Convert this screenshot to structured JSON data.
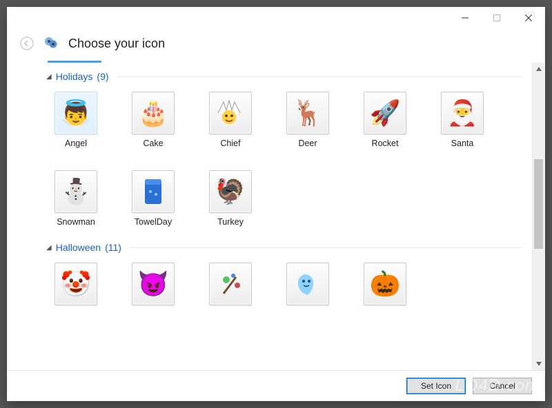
{
  "titlebar": {
    "minimize": "–",
    "maximize": "□",
    "close": "✕"
  },
  "header": {
    "title": "Choose your icon"
  },
  "categories": [
    {
      "name": "Holidays",
      "count": 9,
      "items": [
        {
          "label": "Angel",
          "emoji": "👼",
          "selected": true
        },
        {
          "label": "Cake",
          "emoji": "🎂"
        },
        {
          "label": "Chief",
          "emoji": "😀"
        },
        {
          "label": "Deer",
          "emoji": "🦌"
        },
        {
          "label": "Rocket",
          "emoji": "🚀"
        },
        {
          "label": "Santa",
          "emoji": "🎅"
        },
        {
          "label": "Snowman",
          "emoji": "⛄"
        },
        {
          "label": "TowelDay",
          "emoji": "🟦"
        },
        {
          "label": "Turkey",
          "emoji": "🦃"
        }
      ]
    },
    {
      "name": "Halloween",
      "count": 11,
      "items": [
        {
          "label": "",
          "emoji": "🤡"
        },
        {
          "label": "",
          "emoji": "😈"
        },
        {
          "label": "",
          "emoji": "🪄"
        },
        {
          "label": "",
          "emoji": "👻"
        },
        {
          "label": "",
          "emoji": "🎃"
        }
      ]
    }
  ],
  "footer": {
    "set_icon": "Set Icon",
    "cancel": "Cancel"
  },
  "watermark": "LO4D.com"
}
